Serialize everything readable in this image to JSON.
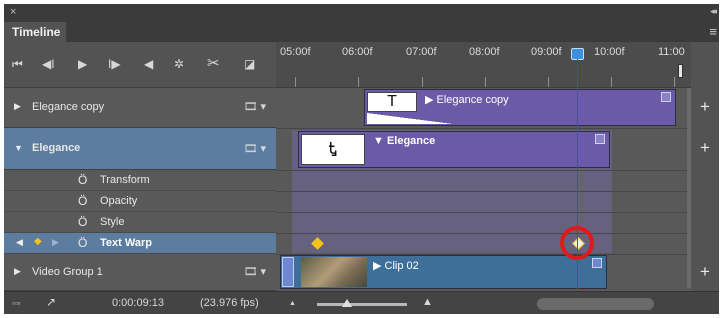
{
  "panel": {
    "close_glyph": "×",
    "collapse_glyph": "◂◂",
    "tab_label": "Timeline",
    "menu_glyph": "≡"
  },
  "toolbar": {
    "first_frame_glyph": "⏮",
    "prev_frame_glyph": "◀I",
    "play_glyph": "▶",
    "next_frame_glyph": "I▶",
    "audio_glyph": "◀",
    "settings_glyph": "✲",
    "split_glyph": "✂",
    "transition_glyph": "◪"
  },
  "ruler": {
    "ticks": [
      "05:00f",
      "06:00f",
      "07:00f",
      "08:00f",
      "09:00f",
      "10:00f",
      "11:00"
    ]
  },
  "layers": [
    {
      "name": "Elegance copy",
      "arrow": "▶",
      "film": "🎞 ▾",
      "selected": false
    },
    {
      "name": "Elegance",
      "arrow": "▼",
      "film": "🎞 ▾",
      "selected": true
    },
    {
      "name": "Video Group 1",
      "arrow": "▶",
      "film": "🎞 ▾",
      "selected": false
    }
  ],
  "properties": [
    {
      "name": "Transform",
      "stopwatch": "Ö"
    },
    {
      "name": "Opacity",
      "stopwatch": "Ö"
    },
    {
      "name": "Style",
      "stopwatch": "Ö"
    },
    {
      "name": "Text Warp",
      "stopwatch": "Ö",
      "selected": true
    }
  ],
  "keyframe_nav": {
    "prev": "◀",
    "add": "◆",
    "next": "▶"
  },
  "clips": {
    "elegance_copy": {
      "title": "▶ Elegance copy",
      "thumb": "T"
    },
    "elegance": {
      "title": "▼ Elegance",
      "thumb": "Ꮏ"
    },
    "video": {
      "title": "▶ Clip 02"
    }
  },
  "add_track_glyph": "+",
  "status": {
    "render_glyph": "▫▫▫",
    "convert_glyph": "↗",
    "timecode": "0:00:09:13",
    "fps": "(23.976 fps)",
    "zoom_out_glyph": "▲",
    "zoom_in_glyph": "▲"
  },
  "colors": {
    "text_clip": "#6a5aa8",
    "video_clip": "#3d6f98",
    "selection": "#5c7ca0",
    "playhead": "#d62020",
    "keyframe": "#f4c21a",
    "highlight_ring": "#e01a1a"
  }
}
